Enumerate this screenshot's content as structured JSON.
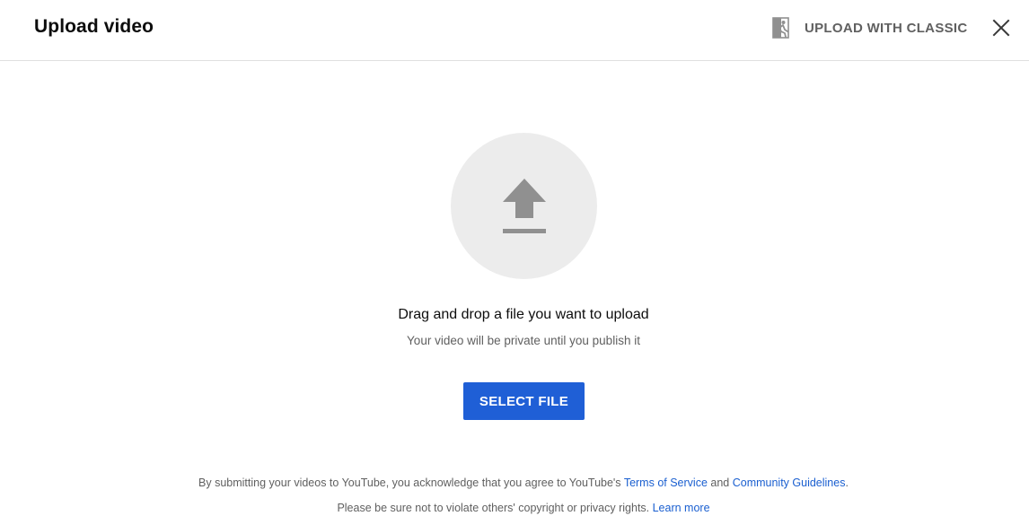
{
  "header": {
    "title": "Upload video",
    "classic_label": "UPLOAD WITH CLASSIC",
    "classic_icon": "exit-person-icon",
    "close_icon": "close-icon"
  },
  "main": {
    "upload_icon": "upload-arrow-icon",
    "drag_text": "Drag and drop a file you want to upload",
    "private_text": "Your video will be private until you publish it",
    "select_button": "SELECT FILE"
  },
  "footer": {
    "line1_prefix": "By submitting your videos to YouTube, you acknowledge that you agree to YouTube's ",
    "terms_link": "Terms of Service",
    "line1_and": " and ",
    "guidelines_link": "Community Guidelines",
    "line1_suffix": ".",
    "line2_prefix": "Please be sure not to violate others' copyright or privacy rights. ",
    "learn_more_link": "Learn more"
  },
  "colors": {
    "primary_button": "#1f5fd6",
    "link": "#1a5fd0",
    "muted_text": "#606060",
    "circle_bg": "#ececec",
    "icon_gray": "#909090"
  }
}
